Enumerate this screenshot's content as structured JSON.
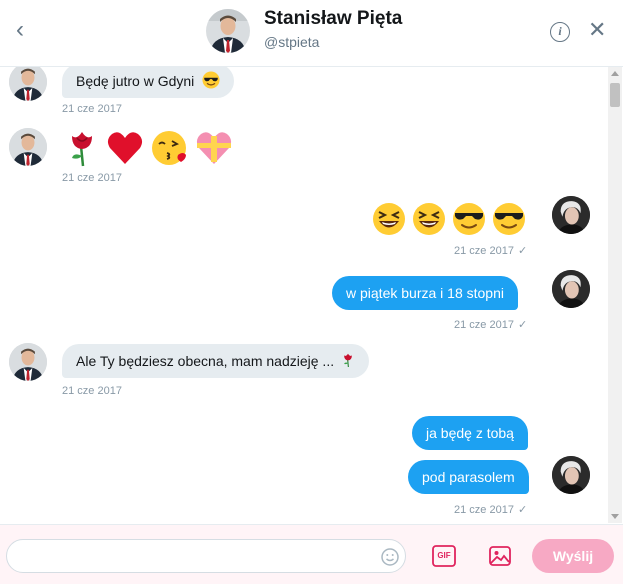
{
  "header": {
    "name": "Stanisław Pięta",
    "handle": "@stpieta",
    "back_icon": "chevron-left-icon",
    "info_icon": "info-icon",
    "close_icon": "close-icon"
  },
  "messages": [
    {
      "direction": "in",
      "text": "Będę jutro w Gdyni",
      "emoji_after": [
        "cool-sunglasses"
      ],
      "timestamp": "21 cze 2017"
    },
    {
      "direction": "in",
      "emoji_only": [
        "rose",
        "red-heart",
        "kissing-face",
        "heart-with-ribbon"
      ],
      "timestamp": "21 cze 2017"
    },
    {
      "direction": "out",
      "emoji_only": [
        "laughing-face",
        "laughing-face",
        "cool-sunglasses",
        "cool-sunglasses"
      ],
      "timestamp": "21 cze 2017",
      "read_mark": "✓"
    },
    {
      "direction": "out",
      "text": "w piątek burza i 18 stopni",
      "timestamp": "21 cze 2017",
      "read_mark": "✓"
    },
    {
      "direction": "in",
      "text": "Ale Ty będziesz obecna, mam nadzieję ...",
      "emoji_after": [
        "rose"
      ],
      "timestamp": "21 cze 2017"
    },
    {
      "direction": "out",
      "text": "ja będę z tobą",
      "timestamp": ""
    },
    {
      "direction": "out",
      "text": "pod parasolem",
      "timestamp": "21 cze 2017",
      "read_mark": "✓"
    }
  ],
  "composer": {
    "placeholder": "",
    "emoji_icon": "smiley-icon",
    "gif_label": "GIF",
    "image_icon": "image-icon",
    "send_label": "Wyślij"
  },
  "colors": {
    "outgoing_bubble": "#1da1f2",
    "incoming_bubble": "#e6ecf0",
    "send_button": "#f7a9c4",
    "accent_pink": "#e0245e"
  }
}
